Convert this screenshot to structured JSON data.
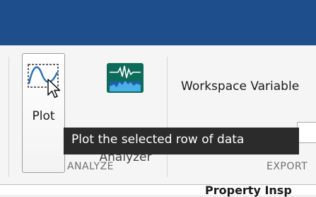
{
  "toolstrip": {
    "analyze_section": {
      "title": "ANALYZE",
      "plot_button": {
        "label": "Plot",
        "icon": "plot-line-icon"
      },
      "analyzer_button": {
        "label": "Analyzer",
        "icon": "signal-analyzer-icon"
      }
    },
    "export_section": {
      "title": "EXPORT",
      "workspace_label": "Workspace Variable"
    }
  },
  "tooltip": {
    "text": "Plot the selected row of data"
  },
  "panel": {
    "title": "Property Insp"
  },
  "colors": {
    "titlebar": "#1e4f8c",
    "tooltip_bg": "#2b2b2b",
    "analyzer_icon_bg": "#0d6b5a",
    "analyzer_bars": "#3a8ed8"
  }
}
